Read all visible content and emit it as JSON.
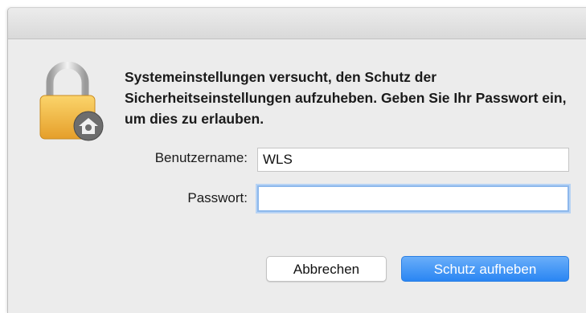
{
  "dialog": {
    "message": "Systemeinstellungen versucht, den Schutz der Sicherheitseinstellungen aufzuheben. Geben Sie Ihr Passwort ein, um dies zu erlauben.",
    "lock_icon": "lock-with-gear-icon"
  },
  "form": {
    "username_label": "Benutzername:",
    "username_value": "WLS",
    "password_label": "Passwort:",
    "password_value": ""
  },
  "buttons": {
    "cancel_label": "Abbrechen",
    "unlock_label": "Schutz aufheben"
  },
  "colors": {
    "accent": "#2a86f3",
    "focus_ring": "#8db8ec",
    "lock_body": "#f5b73f"
  }
}
